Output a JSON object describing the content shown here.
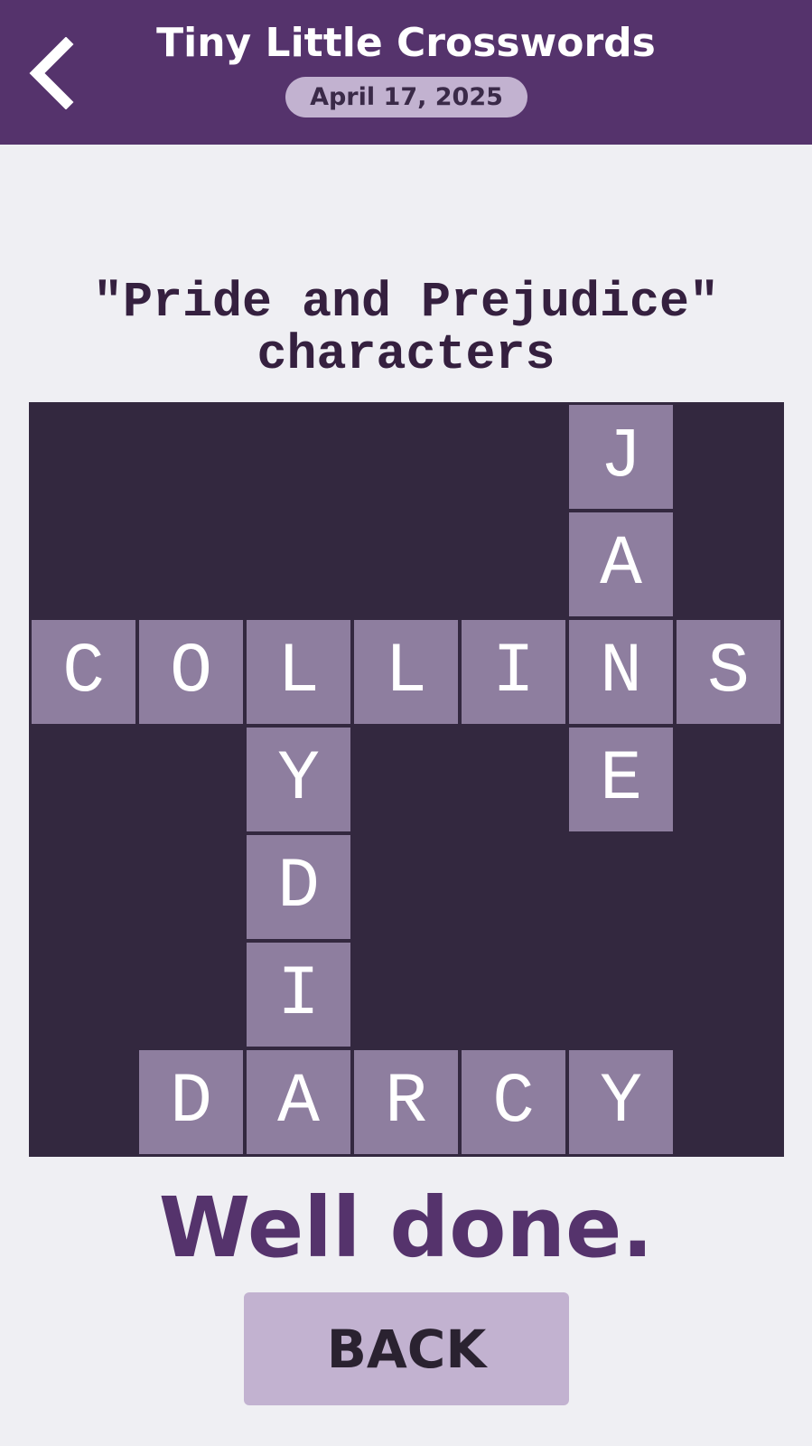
{
  "header": {
    "back_icon": "chevron-left-icon",
    "title": "Tiny Little Crosswords",
    "date": "April 17, 2025"
  },
  "puzzle": {
    "title": "\"Pride and Prejudice\" characters",
    "rows": 7,
    "cols": 7,
    "cells": [
      {
        "row": 0,
        "col": 5,
        "letter": "J"
      },
      {
        "row": 1,
        "col": 5,
        "letter": "A"
      },
      {
        "row": 2,
        "col": 0,
        "letter": "C"
      },
      {
        "row": 2,
        "col": 1,
        "letter": "O"
      },
      {
        "row": 2,
        "col": 2,
        "letter": "L"
      },
      {
        "row": 2,
        "col": 3,
        "letter": "L"
      },
      {
        "row": 2,
        "col": 4,
        "letter": "I"
      },
      {
        "row": 2,
        "col": 5,
        "letter": "N"
      },
      {
        "row": 2,
        "col": 6,
        "letter": "S"
      },
      {
        "row": 3,
        "col": 2,
        "letter": "Y"
      },
      {
        "row": 3,
        "col": 5,
        "letter": "E"
      },
      {
        "row": 4,
        "col": 2,
        "letter": "D"
      },
      {
        "row": 5,
        "col": 2,
        "letter": "I"
      },
      {
        "row": 6,
        "col": 1,
        "letter": "D"
      },
      {
        "row": 6,
        "col": 2,
        "letter": "A"
      },
      {
        "row": 6,
        "col": 3,
        "letter": "R"
      },
      {
        "row": 6,
        "col": 4,
        "letter": "C"
      },
      {
        "row": 6,
        "col": 5,
        "letter": "Y"
      }
    ]
  },
  "message": "Well done.",
  "back_button_label": "BACK",
  "colors": {
    "header_bg": "#55336c",
    "grid_bg": "#33283f",
    "cell_bg": "#8e7e9f",
    "pill_bg": "#c2b2d0",
    "page_bg": "#efeff3"
  }
}
